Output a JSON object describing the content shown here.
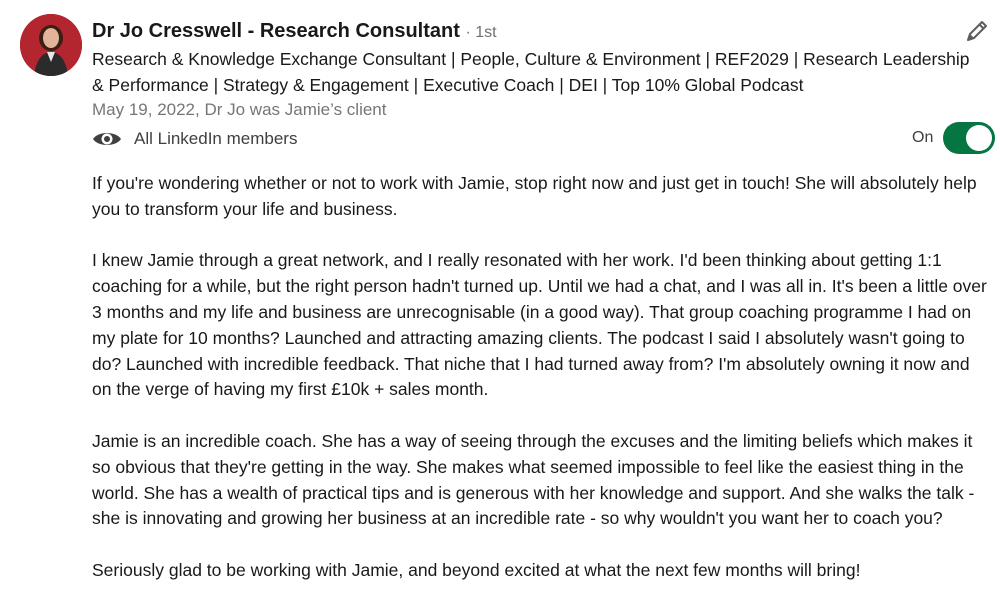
{
  "recommender": {
    "name": "Dr Jo Cresswell - Research Consultant",
    "degree": "· 1st",
    "headline": "Research & Knowledge Exchange Consultant | People, Culture & Environment | REF2029 | Research Leadership & Performance | Strategy & Engagement | Executive Coach | DEI | Top 10% Global Podcast",
    "relationship": "May 19, 2022, Dr Jo was Jamie’s client"
  },
  "visibility": {
    "label": "All LinkedIn members",
    "toggle_label": "On",
    "toggle_state": "on"
  },
  "recommendation": {
    "paragraphs": [
      "If you're wondering whether or not to work with Jamie, stop right now and just get in touch! She will absolutely help you to transform your life and business.",
      "I knew Jamie through a great network, and I really resonated with her work. I'd been thinking about getting 1:1 coaching for a while, but the right person hadn't turned up. Until we had a chat, and I was all in. It's been a little over 3 months and my life and business are unrecognisable (in a good way). That group coaching programme I had on my plate for 10 months? Launched and attracting amazing clients. The podcast I said I absolutely wasn't going to do? Launched with incredible feedback. That niche that I had turned away from? I'm absolutely owning it now and on the verge of having my first £10k + sales month.",
      "Jamie is an incredible coach. She has a way of seeing through the excuses and the limiting beliefs which makes it so obvious that they're getting in the way. She makes what seemed impossible to feel like the easiest thing in the world. She has a wealth of practical tips and is generous with her knowledge and support. And she walks the talk - she is innovating and growing her business at an incredible rate - so why wouldn't you want her to coach you?",
      "Seriously glad to be working with Jamie, and beyond excited at what the next few months will bring!"
    ]
  },
  "icons": {
    "avatar": "profile-photo",
    "edit": "pencil-icon",
    "visibility": "eye-icon"
  },
  "colors": {
    "toggle_on": "#057642",
    "avatar_bg": "#b3262f",
    "meta_text": "#767676"
  }
}
